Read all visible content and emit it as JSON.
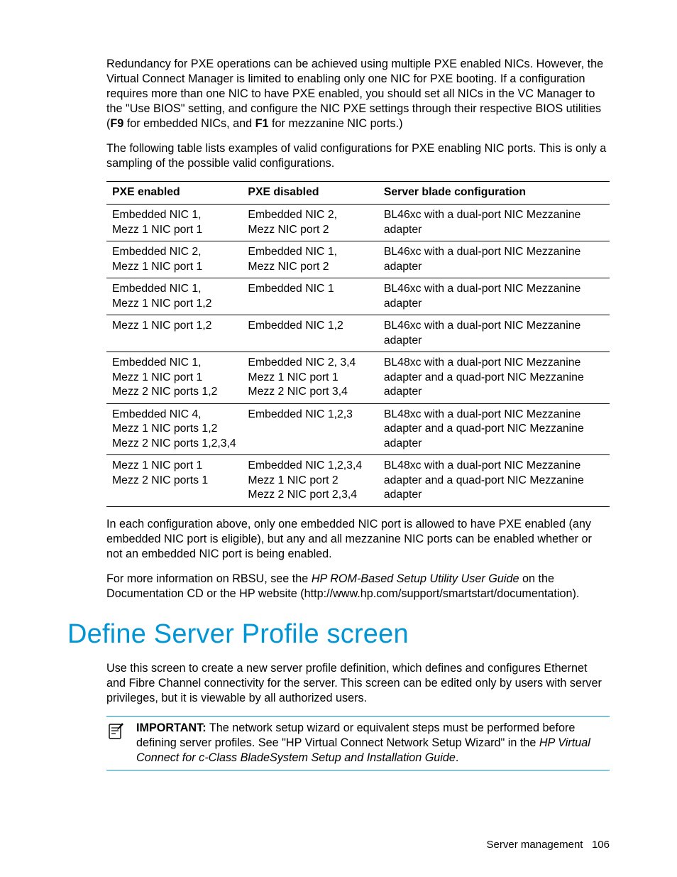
{
  "para1_a": "Redundancy for PXE operations can be achieved using multiple PXE enabled NICs. However, the Virtual Connect Manager is limited to enabling only one NIC for PXE booting. If a configuration requires more than one NIC to have PXE enabled, you should set all NICs in the VC Manager to the \"Use BIOS\" setting, and configure the NIC PXE settings through their respective BIOS utilities (",
  "para1_f9": "F9",
  "para1_b": " for embedded NICs, and ",
  "para1_f1": "F1",
  "para1_c": " for mezzanine NIC ports.)",
  "para2": "The following table lists examples of valid configurations for PXE enabling NIC ports. This is only a sampling of the possible valid configurations.",
  "table": {
    "headers": [
      "PXE enabled",
      "PXE disabled",
      "Server blade configuration"
    ],
    "rows": [
      {
        "c1": [
          "Embedded NIC 1,",
          "Mezz 1 NIC port 1"
        ],
        "c2": [
          "Embedded NIC 2,",
          "Mezz NIC port 2"
        ],
        "c3": [
          "BL46xc with a dual-port NIC Mezzanine adapter"
        ]
      },
      {
        "c1": [
          "Embedded NIC 2,",
          "Mezz 1 NIC port 1"
        ],
        "c2": [
          "Embedded NIC 1,",
          "Mezz NIC port 2"
        ],
        "c3": [
          "BL46xc with a dual-port NIC Mezzanine adapter"
        ]
      },
      {
        "c1": [
          "Embedded NIC 1,",
          "Mezz 1 NIC port 1,2"
        ],
        "c2": [
          "Embedded NIC 1"
        ],
        "c3": [
          "BL46xc with a dual-port NIC Mezzanine adapter"
        ]
      },
      {
        "c1": [
          "Mezz 1 NIC port 1,2"
        ],
        "c2": [
          "Embedded NIC 1,2"
        ],
        "c3": [
          "BL46xc with a dual-port NIC Mezzanine adapter"
        ]
      },
      {
        "c1": [
          "Embedded NIC 1,",
          "Mezz 1 NIC port 1",
          "Mezz 2 NIC ports 1,2"
        ],
        "c2": [
          "Embedded NIC 2, 3,4",
          "Mezz 1 NIC port 1",
          "Mezz 2 NIC port 3,4"
        ],
        "c3": [
          "BL48xc with a dual-port NIC Mezzanine adapter and a quad-port NIC Mezzanine adapter"
        ]
      },
      {
        "c1": [
          "Embedded NIC 4,",
          "Mezz 1 NIC ports 1,2",
          "Mezz 2 NIC ports 1,2,3,4"
        ],
        "c2": [
          "Embedded NIC 1,2,3"
        ],
        "c3": [
          "BL48xc with a dual-port NIC Mezzanine adapter and a quad-port NIC Mezzanine adapter"
        ]
      },
      {
        "c1": [
          "Mezz 1 NIC port 1",
          "Mezz 2 NIC ports 1"
        ],
        "c2": [
          "Embedded NIC 1,2,3,4",
          "Mezz 1 NIC port 2",
          "Mezz 2 NIC port 2,3,4"
        ],
        "c3": [
          "BL48xc with a dual-port NIC Mezzanine adapter and a quad-port NIC Mezzanine adapter"
        ]
      }
    ]
  },
  "para3": "In each configuration above, only one embedded NIC port is allowed to have PXE enabled (any embedded NIC port is eligible), but any and all mezzanine NIC ports can be enabled whether or not an embedded NIC port is being enabled.",
  "para4_a": "For more information on RBSU, see the ",
  "para4_i": "HP ROM-Based Setup Utility User Guide",
  "para4_b": " on the Documentation CD or the HP website (http://www.hp.com/support/smartstart/documentation).",
  "heading": "Define Server Profile screen",
  "para5": "Use this screen to create a new server profile definition, which defines and configures Ethernet and Fibre Channel connectivity for the server. This screen can be edited only by users with server privileges, but it is viewable by all authorized users.",
  "important_label": "IMPORTANT:",
  "important_a": "  The network setup wizard or equivalent steps must be performed before defining server profiles. See \"HP Virtual Connect Network Setup Wizard\" in the ",
  "important_i": "HP Virtual Connect for c-Class BladeSystem Setup and Installation Guide",
  "important_b": ".",
  "footer_section": "Server management",
  "footer_page": "106"
}
